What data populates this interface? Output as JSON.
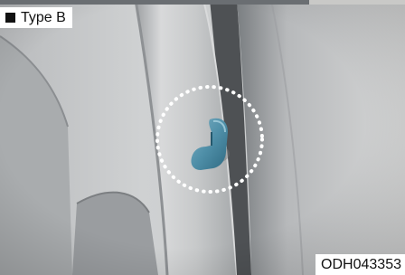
{
  "figure": {
    "type_label": "Type B",
    "marker_icon": "black-square-icon",
    "image_code": "ODH043353",
    "subject": "coat-hook-icon",
    "highlight": "dotted-circle"
  }
}
